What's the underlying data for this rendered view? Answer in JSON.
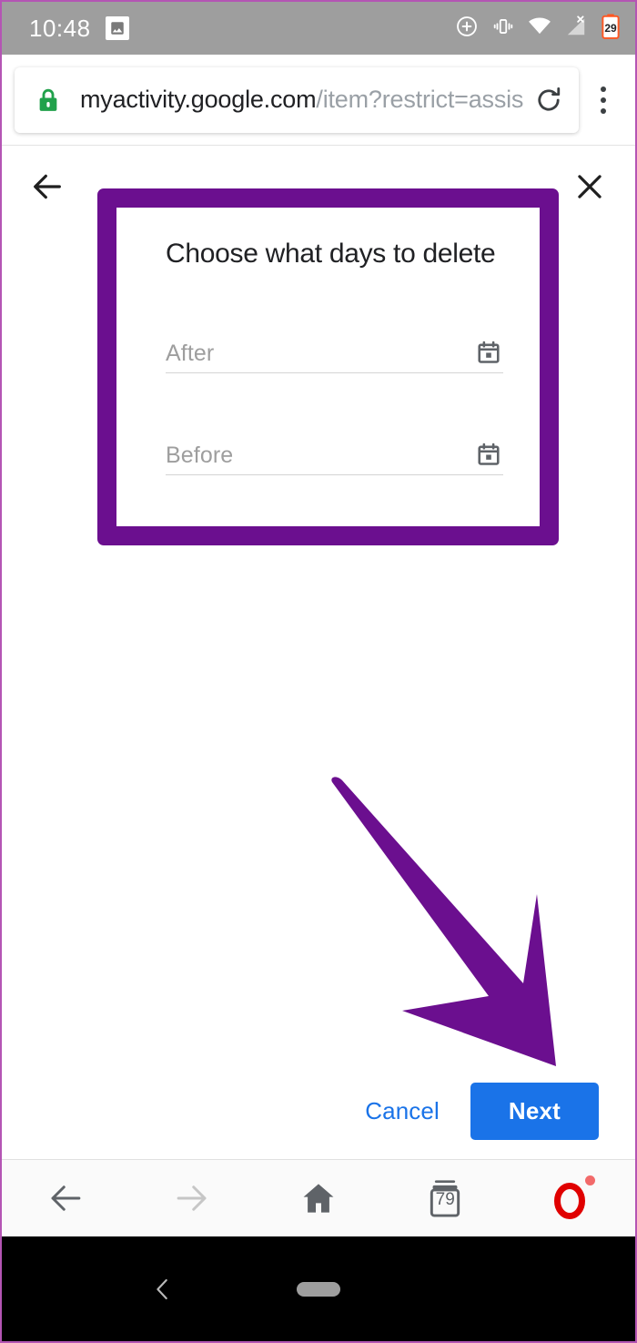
{
  "status_bar": {
    "time": "10:48",
    "icons": [
      "image-notification-icon",
      "screen-record-icon",
      "vibrate-mode-icon",
      "wifi-icon",
      "no-signal-icon",
      "battery-icon"
    ],
    "battery_level": "29",
    "background_color": "#9e9e9e"
  },
  "omnibox": {
    "security_icon": "lock-icon",
    "url_domain": "myactivity.google.com",
    "url_path": "/item?restrict=assis",
    "url_full": "myactivity.google.com/item?restrict=assis",
    "reload_label": "reload-icon",
    "menu_label": "more-options-icon"
  },
  "page_header": {
    "back_label": "back-arrow-icon",
    "close_label": "close-icon"
  },
  "dialog": {
    "title": "Choose what days to delete",
    "highlight_color": "#6b0f8f",
    "fields": [
      {
        "name": "after",
        "placeholder": "After",
        "value": "",
        "icon": "calendar-icon"
      },
      {
        "name": "before",
        "placeholder": "Before",
        "value": "",
        "icon": "calendar-icon"
      }
    ]
  },
  "annotation": {
    "type": "arrow",
    "color": "#6b0f8f",
    "points_to": "Next"
  },
  "actions": {
    "cancel_label": "Cancel",
    "next_label": "Next",
    "primary_color": "#1a73e8",
    "link_color": "#1a73e8"
  },
  "browser_bottom_bar": {
    "items": [
      {
        "name": "back",
        "icon": "back-arrow-icon",
        "enabled": true
      },
      {
        "name": "forward",
        "icon": "forward-arrow-icon",
        "enabled": false
      },
      {
        "name": "home",
        "icon": "home-icon",
        "enabled": true
      },
      {
        "name": "tabs",
        "icon": "tab-counter-icon",
        "count": "79"
      },
      {
        "name": "opera-menu",
        "icon": "opera-logo-icon",
        "badge": true
      }
    ],
    "tab_count": "79"
  },
  "android_nav": {
    "back_label": "nav-back-icon",
    "home_pill_label": "nav-home-pill"
  }
}
